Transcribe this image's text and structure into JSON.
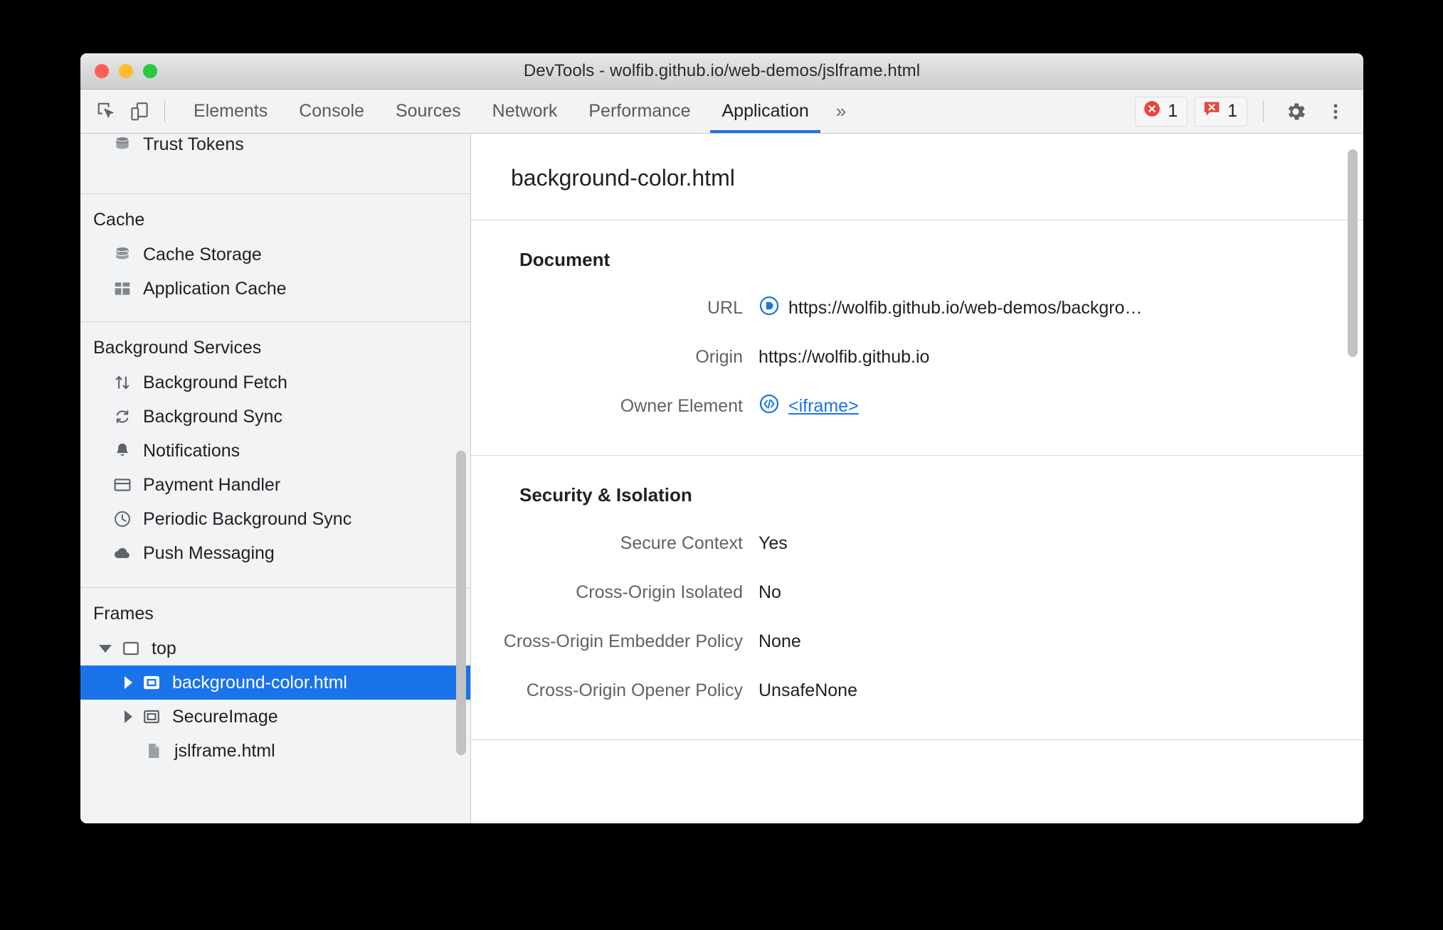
{
  "window": {
    "title": "DevTools - wolfib.github.io/web-demos/jslframe.html"
  },
  "toolbar": {
    "inspect_icon": "inspect-element-icon",
    "device_icon": "device-toolbar-icon",
    "tabs": [
      {
        "label": "Elements",
        "active": false
      },
      {
        "label": "Console",
        "active": false
      },
      {
        "label": "Sources",
        "active": false
      },
      {
        "label": "Network",
        "active": false
      },
      {
        "label": "Performance",
        "active": false
      },
      {
        "label": "Application",
        "active": true
      }
    ],
    "more_tabs_label": "»",
    "errors_count": "1",
    "issues_count": "1",
    "settings_icon": "gear-icon",
    "menu_icon": "kebab-menu-icon",
    "accent_color": "#1a73e8",
    "error_color": "#e8453c"
  },
  "sidebar": {
    "partial_top_item": {
      "label": "Trust Tokens",
      "icon": "database-icon"
    },
    "groups": [
      {
        "title": "Cache",
        "items": [
          {
            "label": "Cache Storage",
            "icon": "database-icon"
          },
          {
            "label": "Application Cache",
            "icon": "grid-icon"
          }
        ]
      },
      {
        "title": "Background Services",
        "items": [
          {
            "label": "Background Fetch",
            "icon": "arrows-up-down-icon"
          },
          {
            "label": "Background Sync",
            "icon": "sync-icon"
          },
          {
            "label": "Notifications",
            "icon": "bell-icon"
          },
          {
            "label": "Payment Handler",
            "icon": "credit-card-icon"
          },
          {
            "label": "Periodic Background Sync",
            "icon": "clock-icon"
          },
          {
            "label": "Push Messaging",
            "icon": "cloud-icon"
          }
        ]
      }
    ],
    "frames": {
      "title": "Frames",
      "tree": [
        {
          "label": "top",
          "icon": "frame-icon",
          "expanded": true,
          "depth": 1,
          "selected": false
        },
        {
          "label": "background-color.html",
          "icon": "iframe-icon",
          "expanded": false,
          "depth": 2,
          "selected": true
        },
        {
          "label": "SecureImage",
          "icon": "iframe-icon",
          "expanded": false,
          "depth": 2,
          "selected": false
        },
        {
          "label": "jslframe.html",
          "icon": "document-icon",
          "depth": 2,
          "selected": false,
          "leaf": true
        }
      ]
    }
  },
  "main": {
    "title": "background-color.html",
    "sections": [
      {
        "title": "Document",
        "rows": [
          {
            "label": "URL",
            "value": "https://wolfib.github.io/web-demos/backgro…",
            "icon": "document-badge-icon",
            "link": false
          },
          {
            "label": "Origin",
            "value": "https://wolfib.github.io",
            "icon": null,
            "link": false
          },
          {
            "label": "Owner Element",
            "value": "<iframe>",
            "icon": "code-badge-icon",
            "link": true
          }
        ]
      },
      {
        "title": "Security & Isolation",
        "rows": [
          {
            "label": "Secure Context",
            "value": "Yes",
            "icon": null,
            "link": false
          },
          {
            "label": "Cross-Origin Isolated",
            "value": "No",
            "icon": null,
            "link": false
          },
          {
            "label": "Cross-Origin Embedder Policy",
            "value": "None",
            "icon": null,
            "link": false
          },
          {
            "label": "Cross-Origin Opener Policy",
            "value": "UnsafeNone",
            "icon": null,
            "link": false
          }
        ]
      }
    ]
  }
}
